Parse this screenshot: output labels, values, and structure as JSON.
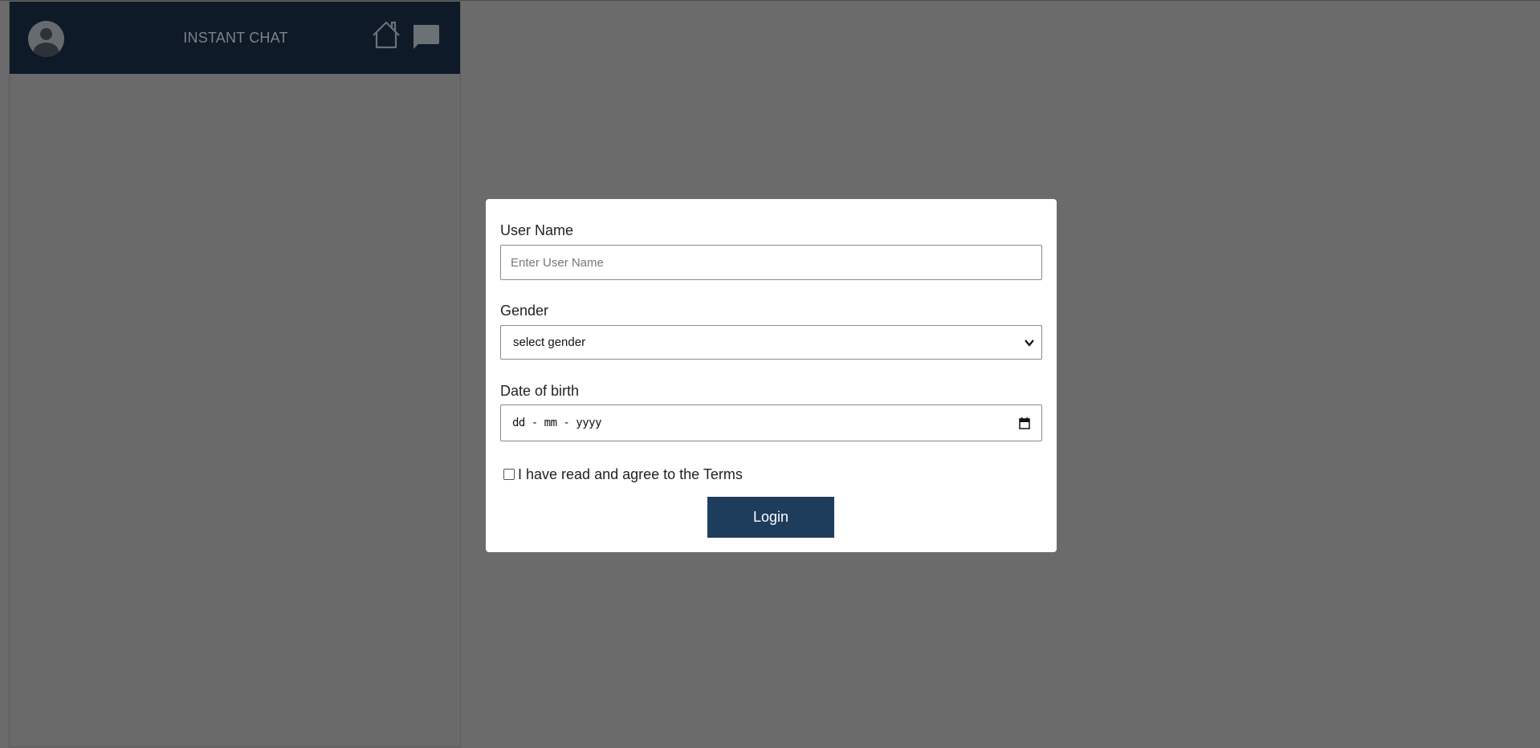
{
  "app": {
    "title": "INSTANT CHAT"
  },
  "header_icons": {
    "avatar": "user-avatar-icon",
    "home": "home-icon",
    "chat": "chat-bubble-icon"
  },
  "login_form": {
    "username_label": "User Name",
    "username_placeholder": "Enter User Name",
    "username_value": "",
    "gender_label": "Gender",
    "gender_selected": "select gender",
    "dob_label": "Date of birth",
    "dob_placeholder": "dd - mm - yyyy",
    "terms_label": "I have read and agree to the Terms",
    "terms_checked": false,
    "login_button": "Login"
  },
  "colors": {
    "overlay": "#6b6b6b",
    "header_bg": "#0e1a28",
    "button_bg": "#1e3d5c"
  }
}
